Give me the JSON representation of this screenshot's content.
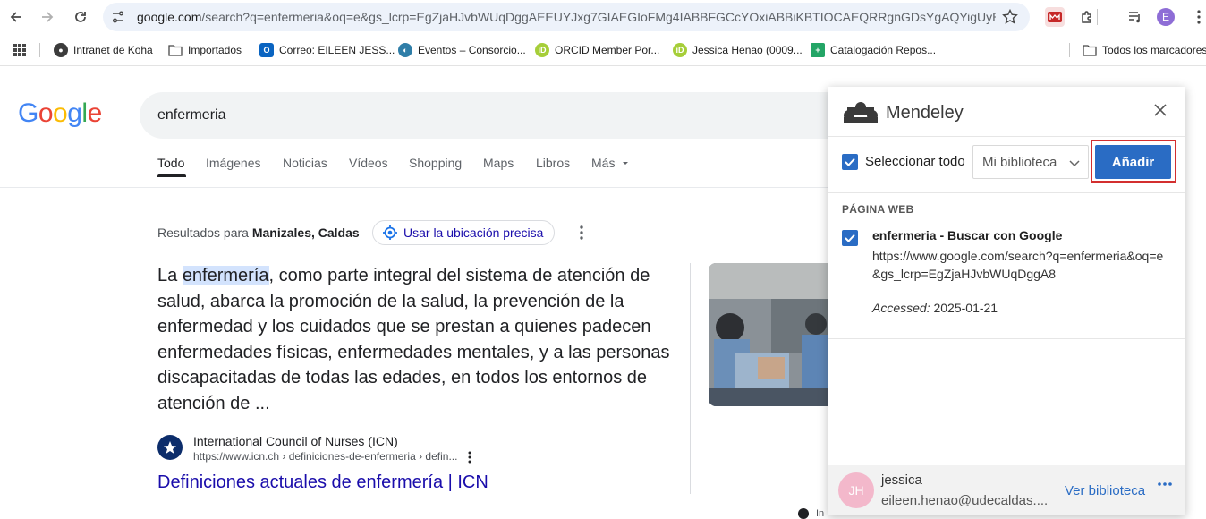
{
  "browser": {
    "url_host": "google.com",
    "url_rest": "/search?q=enfermeria&oq=e&gs_lcrp=EgZjaHJvbWUqDggAEEUYJxg7GIAEGIoFMg4IABBFGCcYOxiABBiKBTIOCAEQRRgnGDsYgAQYigUyBggC...",
    "profile_initial": "E",
    "bookmarks": [
      {
        "label": "Intranet de Koha",
        "icon": "globe-icon"
      },
      {
        "label": "Importados",
        "icon": "folder-icon"
      },
      {
        "label": "Correo: EILEEN JESS...",
        "icon": "outlook-icon"
      },
      {
        "label": "Eventos – Consorcio...",
        "icon": "globe-icon"
      },
      {
        "label": "ORCID Member Por...",
        "icon": "orcid-icon"
      },
      {
        "label": "Jessica Henao (0009...",
        "icon": "orcid-icon"
      },
      {
        "label": "Catalogación Repos...",
        "icon": "sheets-icon"
      }
    ],
    "all_bookmarks": "Todos los marcadores"
  },
  "google": {
    "logo_letters": [
      "G",
      "o",
      "o",
      "g",
      "l",
      "e"
    ],
    "logo_colors": [
      "#4285f4",
      "#ea4335",
      "#fbbc05",
      "#4285f4",
      "#34a853",
      "#ea4335"
    ],
    "query": "enfermeria",
    "tabs": [
      "Todo",
      "Imágenes",
      "Noticias",
      "Vídeos",
      "Shopping",
      "Maps",
      "Libros",
      "Más"
    ],
    "results_for_prefix": "Resultados para ",
    "results_for_place": "Manizales, Caldas",
    "location_button": "Usar la ubicación precisa",
    "snippet_pre": "La ",
    "snippet_highlight": "enfermería",
    "snippet_post": ", como parte integral del sistema de atención de salud, abarca la promoción de la salud, la prevención de la enfermedad y los cuidados que se prestan a quienes padecen enfermedades físicas, enfermedades mentales, y a las personas discapacitadas de todas las edades, en todos los entornos de atención de ...",
    "result_site_name": "International Council of Nurses (ICN)",
    "result_site_url": "https://www.icn.ch › definiciones-de-enfermeria › defin...",
    "result_title": "Definiciones actuales de enfermería | ICN",
    "footer_partial": "In"
  },
  "mendeley": {
    "title": "Mendeley",
    "select_all": "Seleccionar todo",
    "library": "Mi biblioteca",
    "add_button": "Añadir",
    "section": "PÁGINA WEB",
    "item_title": "enfermeria - Buscar con Google",
    "item_url": "https://www.google.com/search?q=enfermeria&oq=e&gs_lcrp=EgZjaHJvbWUqDggA8",
    "accessed_label": "Accessed:",
    "accessed_date": "2025-01-21",
    "user_name": "jessica",
    "user_email": "eileen.henao@udecaldas....",
    "user_initials": "JH",
    "view_library": "Ver biblioteca",
    "accent_color": "#2a6cc4",
    "highlight_frame_color": "#d32f2f"
  }
}
